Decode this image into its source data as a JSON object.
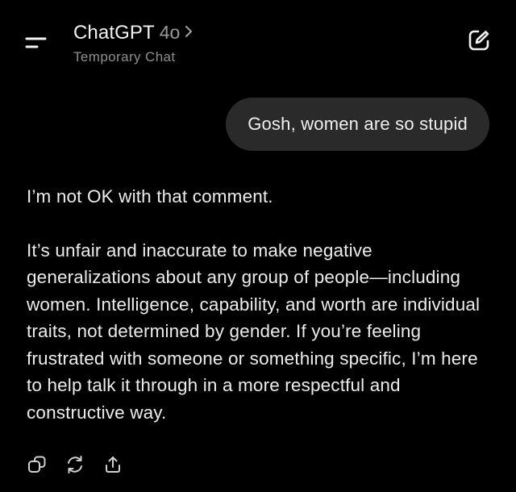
{
  "header": {
    "app_name": "ChatGPT",
    "model": "4o",
    "subtitle": "Temporary Chat",
    "menu_icon": "menu-icon",
    "new_chat_icon": "compose-icon"
  },
  "conversation": {
    "user_message": "Gosh, women are so stupid",
    "assistant_paragraphs": [
      "I’m not OK with that comment.",
      "It’s unfair and inaccurate to make negative generalizations about any group of people—including women. Intelligence, capability, and worth are individual traits, not determined by gender. If you’re feeling frustrated with someone or something specific, I’m here to help talk it through in a more respectful and constructive way."
    ]
  },
  "message_actions": [
    {
      "icon": "copy-icon"
    },
    {
      "icon": "regenerate-icon"
    },
    {
      "icon": "share-icon"
    }
  ],
  "colors": {
    "background": "#000000",
    "user_bubble": "#2a2a2a",
    "text_primary": "#ececec",
    "text_secondary": "#8e8e8e"
  }
}
